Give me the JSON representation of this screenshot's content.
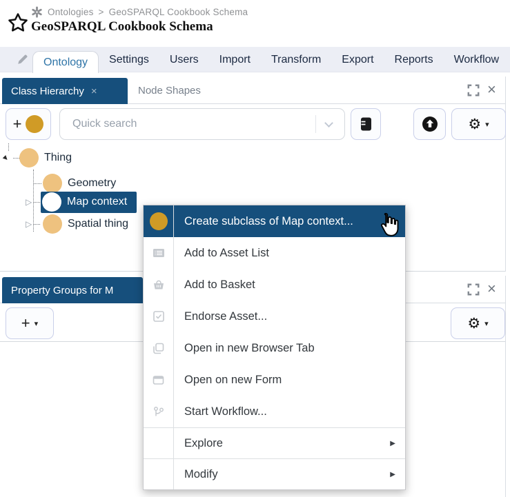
{
  "header": {
    "breadcrumb": {
      "item1": "Ontologies",
      "separator": ">",
      "item2": "GeoSPARQL Cookbook Schema"
    },
    "title": "GeoSPARQL Cookbook Schema"
  },
  "nav_tabs": {
    "active": "Ontology",
    "items": [
      "Ontology",
      "Settings",
      "Users",
      "Import",
      "Transform",
      "Export",
      "Reports",
      "Workflow"
    ]
  },
  "class_hierarchy_panel": {
    "tab_active": "Class Hierarchy",
    "tab_close": "×",
    "tab_plain": "Node Shapes",
    "toolbar": {
      "plus_label": "+",
      "search_placeholder": "Quick search"
    },
    "tree": {
      "root": {
        "label": "Thing"
      },
      "child1": {
        "label": "Geometry"
      },
      "child2": {
        "label": "Map context",
        "selected": true
      },
      "child3": {
        "label": "Spatial thing"
      }
    }
  },
  "context_menu": {
    "items": {
      "create_subclass": "Create subclass of Map context...",
      "add_to_asset_list": "Add to Asset List",
      "add_to_basket": "Add to Basket",
      "endorse_asset": "Endorse Asset...",
      "open_browser_tab": "Open in new Browser Tab",
      "open_new_form": "Open on new Form",
      "start_workflow": "Start Workflow...",
      "explore": "Explore",
      "modify": "Modify"
    },
    "submenu_arrow": "▶"
  },
  "property_groups_panel": {
    "tab_label": "Property Groups for M",
    "toolbar": {
      "plus_label": "+"
    }
  },
  "icons": {
    "favorite": "star-outline",
    "breadcrumb": "asterisk",
    "edit": "pencil",
    "panel_expand": "fullscreen-corners",
    "panel_close": "×",
    "toolbar": [
      "plus-class-circle",
      "book",
      "upload-circle",
      "gear-caret"
    ],
    "menu": [
      "class-circle",
      "asset-list",
      "basket",
      "endorse-check",
      "browser-tabs",
      "form-window",
      "workflow-branch"
    ],
    "cursor": "hand-pointer",
    "tree_expanders": [
      "triangle-open",
      "triangle-closed"
    ]
  },
  "colors": {
    "accent_blue": "#164f7c",
    "class_orange": "#d09b26",
    "class_tan": "#eec27f",
    "navbar_bg": "#eceef5",
    "active_tab_text": "#2e74a7",
    "button_border": "#c9cfe9",
    "muted_gray": "#8f9194"
  }
}
